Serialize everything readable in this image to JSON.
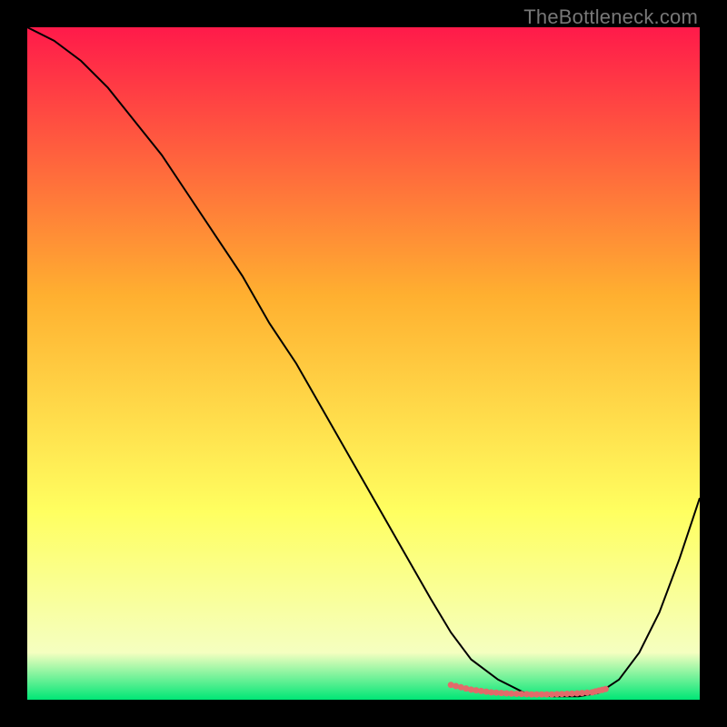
{
  "watermark": "TheBottleneck.com",
  "chart_data": {
    "type": "line",
    "title": "",
    "xlabel": "",
    "ylabel": "",
    "xlim": [
      0,
      100
    ],
    "ylim": [
      0,
      100
    ],
    "grid": false,
    "legend": false,
    "background_gradient": {
      "top": "#ff1a4a",
      "mid_upper": "#ffb030",
      "mid_lower": "#ffff60",
      "near_bottom": "#f5ffc0",
      "bottom": "#00e676"
    },
    "series": [
      {
        "name": "curve",
        "color": "#000000",
        "stroke_width": 2,
        "x": [
          0,
          4,
          8,
          12,
          16,
          20,
          24,
          28,
          32,
          36,
          40,
          44,
          48,
          52,
          56,
          60,
          63,
          66,
          70,
          74,
          78,
          82,
          85,
          88,
          91,
          94,
          97,
          100
        ],
        "y": [
          100,
          98,
          95,
          91,
          86,
          81,
          75,
          69,
          63,
          56,
          50,
          43,
          36,
          29,
          22,
          15,
          10,
          6,
          3,
          1,
          0.5,
          0.5,
          1,
          3,
          7,
          13,
          21,
          30
        ]
      },
      {
        "name": "highlight-band",
        "color": "#e26a6a",
        "stroke_width": 7,
        "style": "dotted",
        "x": [
          63,
          66,
          69,
          72,
          75,
          78,
          81,
          84,
          86
        ],
        "y": [
          2.2,
          1.5,
          1.1,
          0.9,
          0.8,
          0.8,
          0.9,
          1.1,
          1.6
        ]
      }
    ]
  }
}
